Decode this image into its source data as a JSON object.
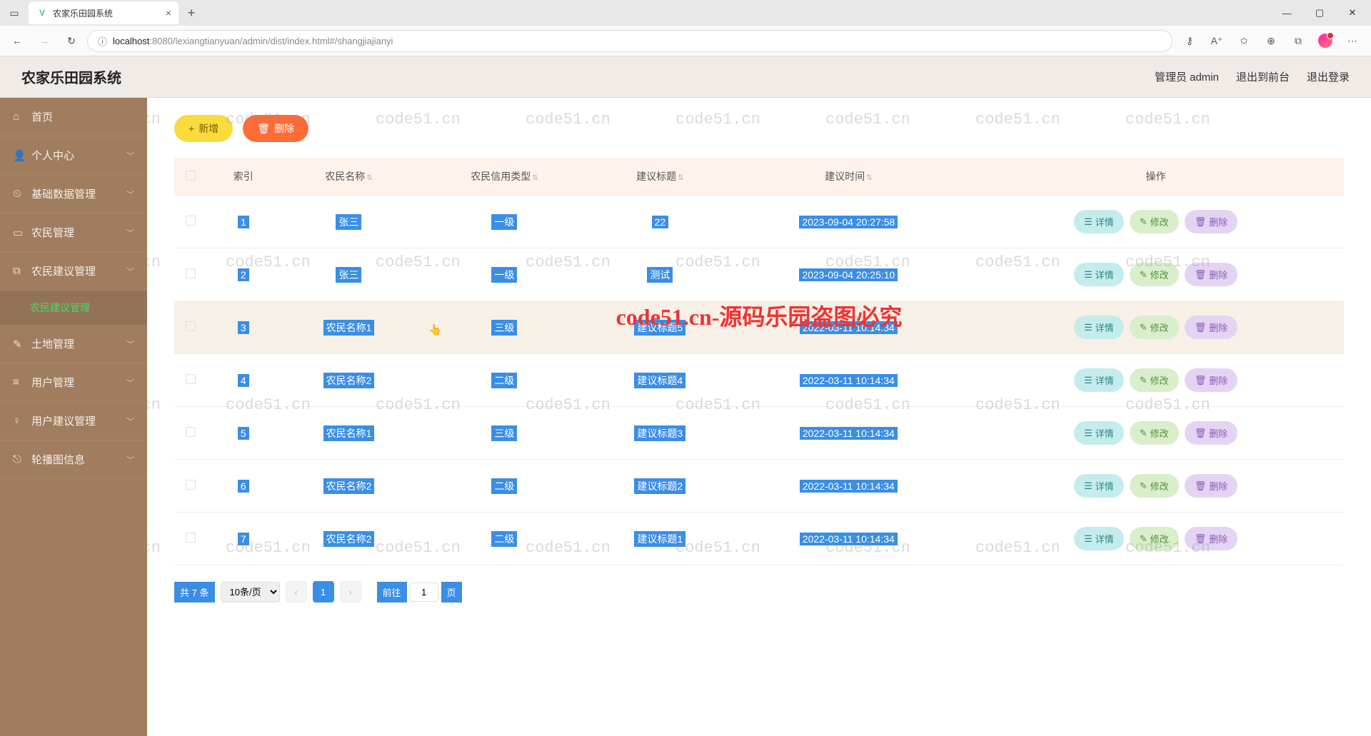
{
  "browser": {
    "tab_title": "农家乐田园系统",
    "url_host": "localhost",
    "url_port": ":8080",
    "url_path": "/lexiangtianyuan/admin/dist/index.html#/shangjiajianyi"
  },
  "header": {
    "app_title": "农家乐田园系统",
    "user_label": "管理员 admin",
    "logout_front": "退出到前台",
    "logout": "退出登录"
  },
  "sidebar": {
    "items": [
      {
        "icon": "⌂",
        "label": "首页"
      },
      {
        "icon": "👤",
        "label": "个人中心"
      },
      {
        "icon": "⏲",
        "label": "基础数据管理"
      },
      {
        "icon": "▭",
        "label": "农民管理"
      },
      {
        "icon": "⧉",
        "label": "农民建议管理"
      },
      {
        "icon": "✎",
        "label": "土地管理"
      },
      {
        "icon": "≡",
        "label": "用户管理"
      },
      {
        "icon": "♀",
        "label": "用户建议管理"
      },
      {
        "icon": "⎋",
        "label": "轮播图信息"
      }
    ],
    "active_sub": "农民建议管理"
  },
  "actions": {
    "add": "新增",
    "delete": "删除"
  },
  "table": {
    "columns": [
      "索引",
      "农民名称",
      "农民信用类型",
      "建议标题",
      "建议时间",
      "操作"
    ],
    "rows": [
      {
        "idx": "1",
        "name": "张三",
        "type": "一级",
        "title": "22",
        "time": "2023-09-04 20:27:58"
      },
      {
        "idx": "2",
        "name": "张三",
        "type": "一级",
        "title": "测试",
        "time": "2023-09-04 20:25:10"
      },
      {
        "idx": "3",
        "name": "农民名称1",
        "type": "三级",
        "title": "建议标题5",
        "time": "2022-03-11 10:14:34"
      },
      {
        "idx": "4",
        "name": "农民名称2",
        "type": "二级",
        "title": "建议标题4",
        "time": "2022-03-11 10:14:34"
      },
      {
        "idx": "5",
        "name": "农民名称1",
        "type": "三级",
        "title": "建议标题3",
        "time": "2022-03-11 10:14:34"
      },
      {
        "idx": "6",
        "name": "农民名称2",
        "type": "二级",
        "title": "建议标题2",
        "time": "2022-03-11 10:14:34"
      },
      {
        "idx": "7",
        "name": "农民名称2",
        "type": "二级",
        "title": "建议标题1",
        "time": "2022-03-11 10:14:34"
      }
    ],
    "row_actions": {
      "detail": "详情",
      "edit": "修改",
      "delete": "删除"
    }
  },
  "pager": {
    "total_prefix": "共",
    "total_count": "7",
    "total_suffix": "条",
    "page_size": "10条/页",
    "current": "1",
    "jump_prefix": "前往",
    "jump_value": "1",
    "jump_suffix": "页"
  },
  "watermark": {
    "text": "code51.cn",
    "red": "code51.cn-源码乐园盗图必究"
  }
}
